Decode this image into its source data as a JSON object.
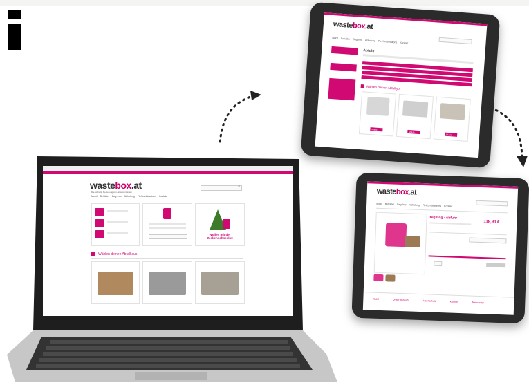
{
  "brand": {
    "name_prefix": "waste",
    "name_highlight": "box",
    "name_suffix": ".at",
    "accent": "#d10a73"
  },
  "laptop": {
    "tagline": "Die schnelle Bestellung von Abfallcontainern",
    "nav": [
      "Mobil",
      "Behälter",
      "Bag-Info",
      "Abholung",
      "Fb-Kumbinations",
      "Kontakt"
    ],
    "tiles": {
      "ad_caption": "Wollen mit der Zeckenschnecke!"
    },
    "section_title": "Wählen deinen Abfall aus"
  },
  "tablet_top": {
    "nav": [
      "Mobil",
      "Behälter",
      "Bag-Info",
      "Abholung",
      "Fb-Kumbinations",
      "Kontakt"
    ],
    "heading": "Abfuhr",
    "section_title": "Wählen deinen Abfalltyp",
    "buttons": [
      "Mulde",
      "Mulde",
      "Mulde"
    ]
  },
  "tablet_bottom": {
    "nav": [
      "Mobil",
      "Behälter",
      "Bag-Info",
      "Abholung",
      "Fb-Kumbinations",
      "Kontakt"
    ],
    "product_title": "Big Bag - Abfuhr",
    "price": "118,90 €",
    "footer_tabs": [
      "Mobil",
      "Unser Bereich",
      "Datenschutz",
      "Kontakt",
      "Newsletter"
    ]
  },
  "icons": [
    "letter-i-icon",
    "curved-arrow-icon",
    "search-icon"
  ]
}
